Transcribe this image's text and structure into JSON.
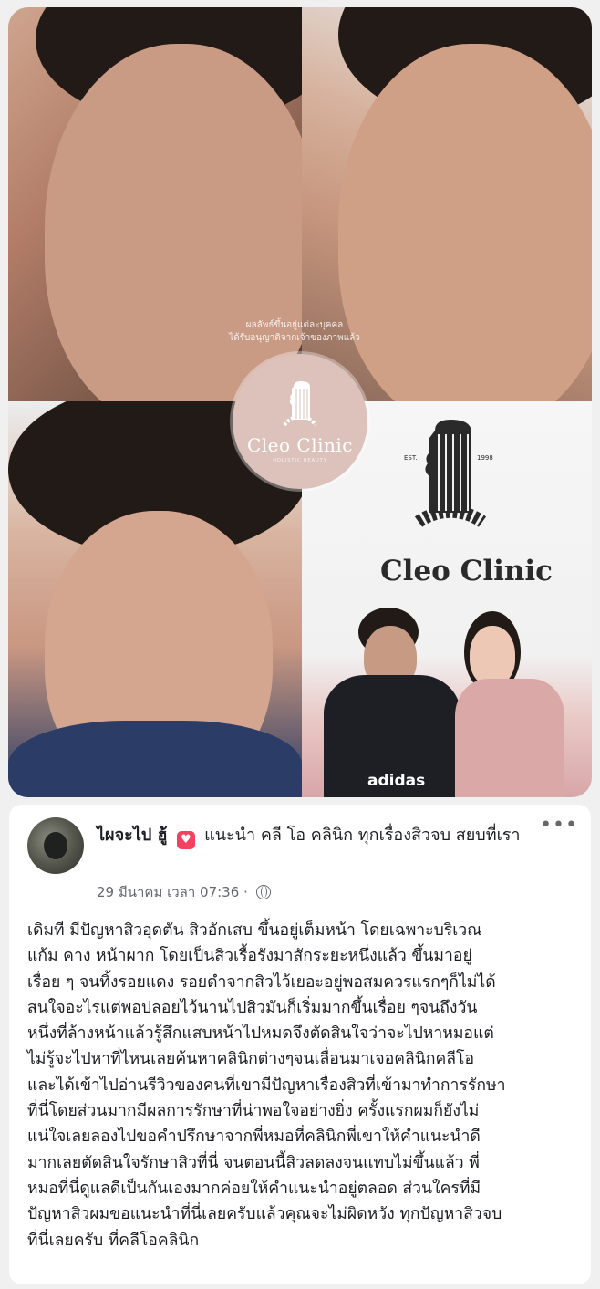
{
  "collage": {
    "disclaimer_lines": [
      "ผลลัพธ์ขึ้นอยู่แต่ละบุคคล",
      "ได้รับอนุญาติจากเจ้าของภาพแล้ว"
    ],
    "badge_name": "Cleo Clinic",
    "badge_subtitle": "HOLISTIC BEAUTY",
    "wall_logo_name": "Cleo Clinic",
    "shirt_text": "adidas",
    "colors": {
      "badge": "#dcc2bb",
      "wall_logo": "#2a2a2a"
    }
  },
  "post": {
    "author": "ไผจะไป ฮู้",
    "recommend_icon": "heart-badge-icon",
    "headline": "แนะนำ คลี โอ คลินิก ทุกเรื่องสิวจบ สยบที่เรา",
    "timestamp": "29 มีนาคม เวลา 07:36 ·",
    "privacy_icon": "globe-icon",
    "more_label": "•••",
    "body_lines": [
      "เดิมที มีปัญหาสิวอุดตัน สิวอักเสบ ขึ้นอยู่เต็มหน้า โดยเฉพาะบริเวณ",
      "แก้ม คาง หน้าผาก โดยเป็นสิวเรื้อรังมาสักระยะหนึ่งแล้ว ขึ้นมาอยู่",
      "เรื่อย ๆ จนทิ้งรอยแดง รอยดำจากสิวไว้เยอะอยู่พอสมควรแรกๆก็ไม่ได้",
      "สนใจอะไรแต่พอปลอยไว้นานไปสิวมันก็เริ่มมากขึ้นเรื่อย ๆจนถึงวัน",
      "หนึ่งที่ล้างหน้าแล้วรู้สึกแสบหน้าไปหมดจึงตัดสินใจว่าจะไปหาหมอแต่",
      "ไม่รู้จะไปหาที่ไหนเลยค้นหาคลินิกต่างๆจนเลื่อนมาเจอคลินิกคลีโอ",
      "และได้เข้าไปอ่านรีวิวของคนที่เขามีปัญหาเรื่องสิวที่เข้ามาทำการรักษา",
      "ที่นี่โดยส่วนมากมีผลการรักษาที่น่าพอใจอย่างยิ่ง ครั้งแรกผมก็ยังไม่",
      "แน่ใจเลยลองไปขอคำปรึกษาจากพี่หมอที่คลินิกพี่เขาให้คำแนะนำดี",
      "มากเลยตัดสินใจรักษาสิวที่นี่ จนตอนนี้สิวลดลงจนแทบไม่ขึ้นแล้ว พี่",
      "หมอที่นี่ดูแลดีเป็นกันเองมากค่อยให้คำแนะนำอยู่ตลอด ส่วนใครที่มี",
      "ปัญหาสิวผมขอแนะนำที่นี่เลยครับแล้วคุณจะไม่ผิดหวัง ทุกปัญหาสิวจบ",
      "ที่นี่เลยครับ ที่คลีโอคลินิก"
    ]
  }
}
